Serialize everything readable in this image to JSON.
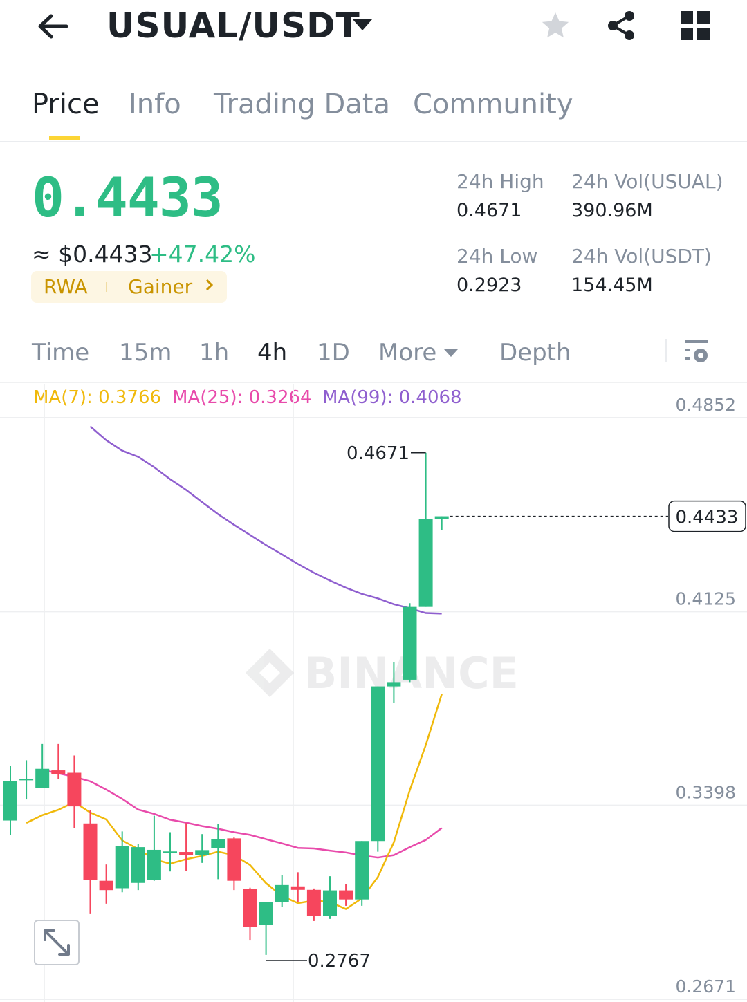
{
  "header": {
    "pair": "USUAL/USDT",
    "icons": [
      "back-arrow-icon",
      "caret-down-icon",
      "star-icon",
      "share-icon",
      "grid-icon"
    ]
  },
  "tabs": [
    {
      "label": "Price",
      "active": true
    },
    {
      "label": "Info",
      "active": false
    },
    {
      "label": "Trading Data",
      "active": false
    },
    {
      "label": "Community",
      "active": false
    }
  ],
  "price": {
    "last": "0.4433",
    "fiat": "≈ $0.4433",
    "change": "+47.42%",
    "tags": [
      "RWA",
      "Gainer"
    ]
  },
  "stats": {
    "high_label": "24h High",
    "high": "0.4671",
    "low_label": "24h Low",
    "low": "0.2923",
    "vol_base_label": "24h Vol(USUAL)",
    "vol_base": "390.96M",
    "vol_quote_label": "24h Vol(USDT)",
    "vol_quote": "154.45M"
  },
  "intervals": [
    {
      "label": "Time",
      "active": false
    },
    {
      "label": "15m",
      "active": false
    },
    {
      "label": "1h",
      "active": false
    },
    {
      "label": "4h",
      "active": true
    },
    {
      "label": "1D",
      "active": false
    },
    {
      "label": "More",
      "active": false
    },
    {
      "label": "Depth",
      "active": false
    }
  ],
  "ma_legend": {
    "ma7": "MA(7): 0.3766",
    "ma25": "MA(25): 0.3264",
    "ma99": "MA(99): 0.4068"
  },
  "colors": {
    "up": "#2ebd85",
    "down": "#f6465d",
    "ma7": "#f0b90b",
    "ma25": "#e84bab",
    "ma99": "#8f5fcf",
    "tag": "#c99400"
  },
  "chart_data": {
    "type": "candlestick",
    "interval": "4h",
    "y_ticks": [
      "0.4852",
      "0.4125",
      "0.3398",
      "0.2671"
    ],
    "ylim": [
      0.2671,
      0.4852
    ],
    "current_price": "0.4433",
    "high_marker": "0.4671",
    "low_marker": "0.2767",
    "watermark": "BINANCE",
    "candles": [
      {
        "o": 0.3292,
        "c": 0.3439,
        "h": 0.3497,
        "l": 0.3237
      },
      {
        "o": 0.3448,
        "c": 0.3448,
        "h": 0.3518,
        "l": 0.3371
      },
      {
        "o": 0.3414,
        "c": 0.3486,
        "h": 0.3579,
        "l": 0.3444
      },
      {
        "o": 0.348,
        "c": 0.3467,
        "h": 0.3579,
        "l": 0.3448
      },
      {
        "o": 0.3471,
        "c": 0.3345,
        "h": 0.3536,
        "l": 0.3265
      },
      {
        "o": 0.3281,
        "c": 0.3069,
        "h": 0.3332,
        "l": 0.2941
      },
      {
        "o": 0.3066,
        "c": 0.3031,
        "h": 0.3127,
        "l": 0.298
      },
      {
        "o": 0.3038,
        "c": 0.3196,
        "h": 0.3251,
        "l": 0.3023
      },
      {
        "o": 0.3058,
        "c": 0.3192,
        "h": 0.3205,
        "l": 0.3031
      },
      {
        "o": 0.3069,
        "c": 0.3182,
        "h": 0.331,
        "l": 0.3066
      },
      {
        "o": 0.3176,
        "c": 0.3176,
        "h": 0.3248,
        "l": 0.3101
      },
      {
        "o": 0.3174,
        "c": 0.3163,
        "h": 0.3282,
        "l": 0.3104
      },
      {
        "o": 0.3163,
        "c": 0.3181,
        "h": 0.3241,
        "l": 0.3133
      },
      {
        "o": 0.3189,
        "c": 0.3222,
        "h": 0.3279,
        "l": 0.3072
      },
      {
        "o": 0.3225,
        "c": 0.3066,
        "h": 0.323,
        "l": 0.3031
      },
      {
        "o": 0.3035,
        "c": 0.2892,
        "h": 0.304,
        "l": 0.2842
      },
      {
        "o": 0.29,
        "c": 0.2985,
        "h": 0.2985,
        "l": 0.2788
      },
      {
        "o": 0.2985,
        "c": 0.305,
        "h": 0.3086,
        "l": 0.2967
      },
      {
        "o": 0.3045,
        "c": 0.3032,
        "h": 0.3098,
        "l": 0.2985
      },
      {
        "o": 0.3032,
        "c": 0.2935,
        "h": 0.3037,
        "l": 0.2915
      },
      {
        "o": 0.2935,
        "c": 0.303,
        "h": 0.3083,
        "l": 0.2923
      },
      {
        "o": 0.303,
        "c": 0.2996,
        "h": 0.3053,
        "l": 0.2972
      },
      {
        "o": 0.2996,
        "c": 0.3215,
        "h": 0.3215,
        "l": 0.2972
      },
      {
        "o": 0.3215,
        "c": 0.3795,
        "h": 0.3795,
        "l": 0.3175
      },
      {
        "o": 0.3795,
        "c": 0.3811,
        "h": 0.3886,
        "l": 0.3734
      },
      {
        "o": 0.382,
        "c": 0.4093,
        "h": 0.4107,
        "l": 0.3811
      },
      {
        "o": 0.4093,
        "c": 0.4423,
        "h": 0.4671,
        "l": 0.4093
      },
      {
        "o": 0.4423,
        "c": 0.4433,
        "h": 0.4433,
        "l": 0.4381
      }
    ],
    "ma7": [
      0.3283,
      0.3312,
      0.3332,
      0.3361,
      0.3322,
      0.3296,
      0.3217,
      0.3185,
      0.3146,
      0.313,
      0.3147,
      0.3159,
      0.3175,
      0.3162,
      0.3125,
      0.3057,
      0.3009,
      0.2982,
      0.2992,
      0.2986,
      0.296,
      0.3,
      0.308,
      0.321,
      0.3406,
      0.3575,
      0.3766
    ],
    "ma25": [
      0.3482,
      0.3469,
      0.3456,
      0.3439,
      0.3408,
      0.3373,
      0.3333,
      0.3317,
      0.3295,
      0.3284,
      0.3271,
      0.3261,
      0.3248,
      0.3238,
      0.3222,
      0.3206,
      0.3189,
      0.3187,
      0.3179,
      0.3172,
      0.3161,
      0.3153,
      0.3162,
      0.3192,
      0.3219,
      0.3264
    ],
    "ma99": [
      0.477,
      0.4718,
      0.4679,
      0.4656,
      0.4617,
      0.4572,
      0.4532,
      0.4486,
      0.4441,
      0.4401,
      0.4363,
      0.4325,
      0.429,
      0.4254,
      0.4221,
      0.4192,
      0.4165,
      0.4142,
      0.4125,
      0.4103,
      0.4088,
      0.407,
      0.4068
    ]
  }
}
